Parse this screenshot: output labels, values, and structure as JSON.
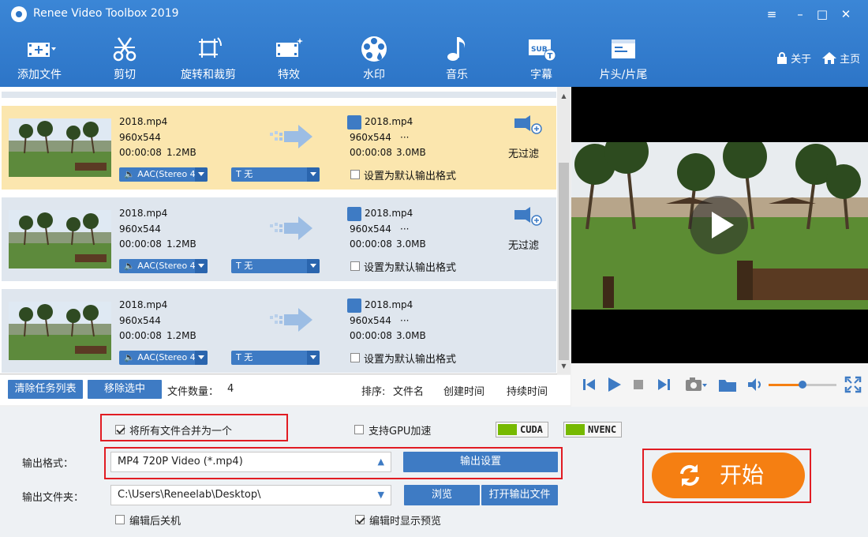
{
  "app": {
    "title": "Renee Video Toolbox 2019"
  },
  "window_controls": [
    "≡",
    "–",
    "□",
    "✕"
  ],
  "toolbar": {
    "items": [
      {
        "label": "添加文件",
        "icon": "add-file-icon"
      },
      {
        "label": "剪切",
        "icon": "scissors-icon"
      },
      {
        "label": "旋转和裁剪",
        "icon": "rotate-crop-icon"
      },
      {
        "label": "特效",
        "icon": "effects-icon"
      },
      {
        "label": "水印",
        "icon": "watermark-icon"
      },
      {
        "label": "音乐",
        "icon": "music-icon"
      },
      {
        "label": "字幕",
        "icon": "subtitle-icon"
      },
      {
        "label": "片头/片尾",
        "icon": "intro-outro-icon"
      }
    ],
    "about_label": "关于",
    "home_label": "主页"
  },
  "files": [
    {
      "selected": true,
      "name": "2018.mp4",
      "resolution": "960x544",
      "duration": "00:00:08",
      "size": "1.2MB",
      "out_name": "2018.mp4",
      "out_resolution": "960x544",
      "out_extra": "···",
      "out_duration": "00:00:08",
      "out_size": "3.0MB",
      "filter_label": "无过滤",
      "audio": "AAC(Stereo 4",
      "subtitle": "无",
      "default_label": "设置为默认输出格式"
    },
    {
      "selected": false,
      "name": "2018.mp4",
      "resolution": "960x544",
      "duration": "00:00:08",
      "size": "1.2MB",
      "out_name": "2018.mp4",
      "out_resolution": "960x544",
      "out_extra": "···",
      "out_duration": "00:00:08",
      "out_size": "3.0MB",
      "filter_label": "无过滤",
      "audio": "AAC(Stereo 4",
      "subtitle": "无",
      "default_label": "设置为默认输出格式"
    },
    {
      "selected": false,
      "name": "2018.mp4",
      "resolution": "960x544",
      "duration": "00:00:08",
      "size": "1.2MB",
      "out_name": "2018.mp4",
      "out_resolution": "960x544",
      "out_extra": "···",
      "out_duration": "00:00:08",
      "out_size": "3.0MB",
      "filter_label": "",
      "audio": "AAC(Stereo 4",
      "subtitle": "无",
      "default_label": "设置为默认输出格式"
    }
  ],
  "list_actions": {
    "clear_label": "清除任务列表",
    "remove_label": "移除选中",
    "count_label": "文件数量：",
    "count_value": "4",
    "sort_label": "排序:",
    "sort_name": "文件名",
    "sort_created": "创建时间",
    "sort_duration": "持续时间"
  },
  "settings": {
    "merge_label": "将所有文件合并为一个",
    "merge_checked": true,
    "gpu_label": "支持GPU加速",
    "gpu_checked": false,
    "cuda_label": "CUDA",
    "nvenc_label": "NVENC",
    "format_label": "输出格式：",
    "format_value": "MP4 720P Video (*.mp4)",
    "output_settings_label": "输出设置",
    "folder_label": "输出文件夹：",
    "folder_value": "C:\\Users\\Reneelab\\Desktop\\",
    "browse_label": "浏览",
    "open_folder_label": "打开输出文件",
    "shutdown_label": "编辑后关机",
    "shutdown_checked": false,
    "preview_label": "编辑时显示预览",
    "preview_checked": true,
    "start_label": "开始"
  },
  "player": {
    "volume_level": 0.5
  },
  "colors": {
    "toolbar": "#2d75c7",
    "accent": "#3e7bc4",
    "selected_row": "#fbe6ae",
    "start": "#f57f12",
    "highlight_box": "#e11c23"
  }
}
